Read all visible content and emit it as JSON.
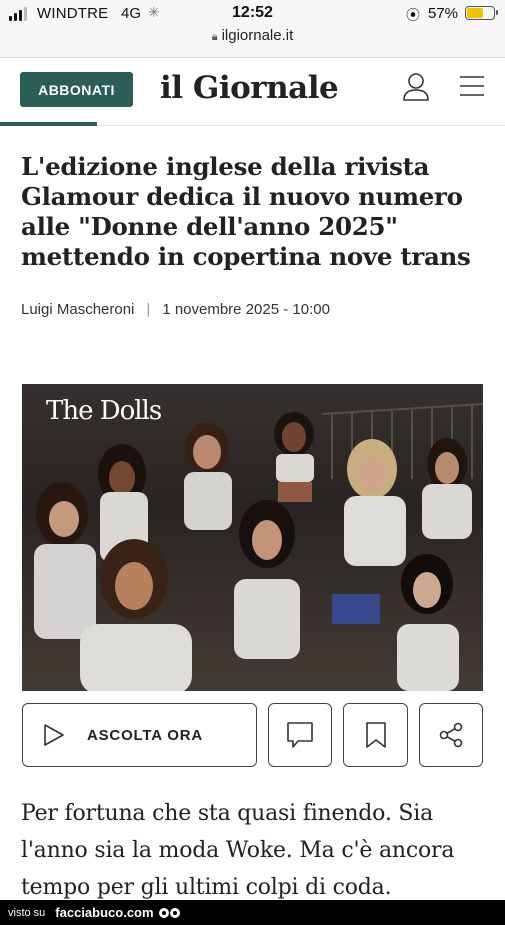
{
  "status_bar": {
    "carrier": "WINDTRE",
    "network": "4G",
    "time": "12:52",
    "battery_percent": "57%",
    "battery_level": 0.57,
    "battery_color": "#f2c200",
    "url": "ilgiornale.it"
  },
  "header": {
    "subscribe_label": "ABBONATI",
    "logo": "il Giornale",
    "accent_color": "#2b5e57"
  },
  "article": {
    "title": "L'edizione inglese della rivista Glamour dedica il nuovo numero alle \"Donne dell'anno 2025\" mettendo in copertina nove trans",
    "author": "Luigi Mascheroni",
    "separator": "|",
    "date": "1 novembre 2025 - 10:00",
    "image_caption": "The Dolls",
    "lead": "Per fortuna che sta quasi finendo. Sia l'anno sia la moda Woke. Ma c'è ancora tempo per gli ultimi colpi di coda."
  },
  "actions": {
    "listen_label": "ASCOLTA ORA",
    "icons": [
      "play-icon",
      "comment-icon",
      "bookmark-icon",
      "share-icon"
    ]
  },
  "footer": {
    "prefix": "visto su",
    "site": "facciabuco.com"
  }
}
